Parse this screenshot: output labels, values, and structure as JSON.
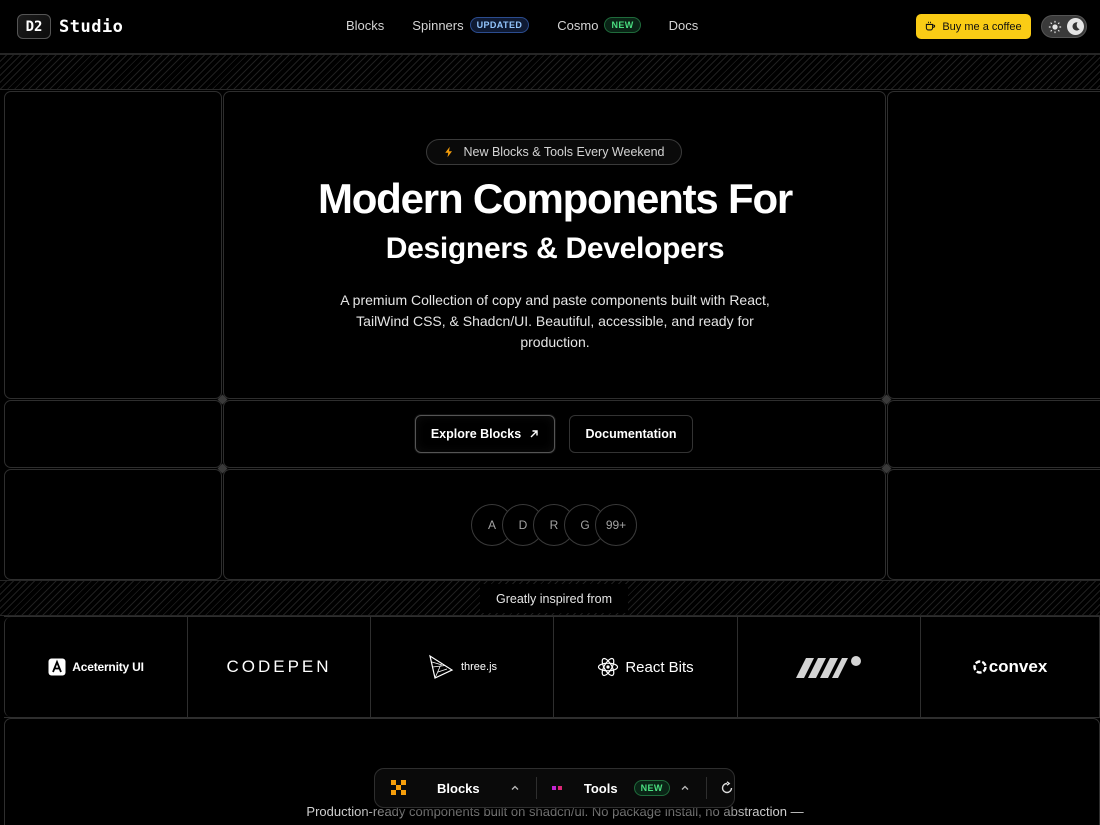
{
  "brand": {
    "mark": "D2",
    "name": "Studio"
  },
  "nav": {
    "blocks": "Blocks",
    "spinners": "Spinners",
    "spinners_badge": "UPDATED",
    "cosmo": "Cosmo",
    "cosmo_badge": "NEW",
    "docs": "Docs"
  },
  "header_actions": {
    "coffee_label": "Buy me a coffee"
  },
  "hero": {
    "pill": "New Blocks & Tools Every Weekend",
    "title": "Modern Components For",
    "subtitle": "Designers & Developers",
    "description": "A premium Collection of copy and paste components built with React, TailWind CSS, & Shadcn/UI. Beautiful, accessible, and ready for production.",
    "primary_cta": "Explore Blocks",
    "secondary_cta": "Documentation",
    "avatars": [
      "A",
      "D",
      "R",
      "G",
      "99+"
    ]
  },
  "inspired": {
    "label": "Greatly inspired from",
    "logos": [
      "Aceternity UI",
      "CODEPEN",
      "three.js",
      "React Bits",
      "",
      "convex"
    ]
  },
  "section": {
    "title": "",
    "description": "Production-ready components built on shadcn/ui. No package install, no abstraction —"
  },
  "dock": {
    "blocks": "Blocks",
    "tools": "Tools",
    "tools_badge": "NEW"
  },
  "colors": {
    "accent": "#facc15",
    "badge_updated": "#93c5fd",
    "badge_new": "#4ade80"
  }
}
